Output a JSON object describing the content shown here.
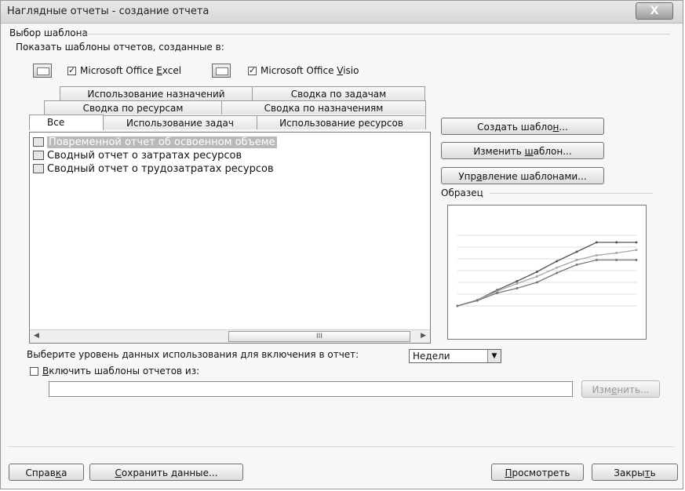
{
  "window": {
    "title": "Наглядные отчеты - создание отчета",
    "close_label": "X"
  },
  "templates_group": {
    "label": "Выбор шаблона",
    "show_label": "Показать шаблоны отчетов, созданные в:",
    "excel_label": "Microsoft Office Excel",
    "excel_checked": true,
    "visio_label": "Microsoft Office Visio",
    "visio_checked": true
  },
  "tabs": {
    "row1": [
      "Использование назначений",
      "Сводка по задачам"
    ],
    "row2": [
      "Сводка по ресурсам",
      "Сводка по назначениям"
    ],
    "row3": [
      "Все",
      "Использование задач",
      "Использование ресурсов"
    ],
    "active": "Все"
  },
  "reports": [
    {
      "label": "Повременной отчет об освоенном объеме",
      "selected": true
    },
    {
      "label": "Сводный отчет о затратах ресурсов",
      "selected": false
    },
    {
      "label": "Сводный отчет о трудозатратах ресурсов",
      "selected": false
    }
  ],
  "scrollbar": {
    "thumb_label": "III"
  },
  "buttons": {
    "create_template": "Создать шаблон...",
    "edit_template": "Изменить шаблон...",
    "manage_templates": "Управление шаблонами...",
    "change": "Изменить...",
    "help": "Справка",
    "save_data": "Сохранить данные...",
    "view": "Просмотреть",
    "close": "Закрыть"
  },
  "sample": {
    "label": "Образец"
  },
  "usage_level": {
    "label": "Выберите уровень данных использования для включения в отчет:",
    "value": "Недели"
  },
  "include_templates": {
    "label": "Включить шаблоны отчетов из:",
    "checked": false,
    "path": ""
  },
  "chart_data": {
    "type": "line",
    "x": [
      1,
      2,
      3,
      4,
      5,
      6,
      7,
      8,
      9,
      10
    ],
    "series": [
      {
        "values": [
          0,
          1.0,
          2.7,
          4.2,
          5.8,
          7.6,
          9.2,
          10.8,
          10.8,
          10.8
        ]
      },
      {
        "values": [
          0,
          1.0,
          2.5,
          3.8,
          5.0,
          6.5,
          7.8,
          8.6,
          9.0,
          9.5
        ]
      },
      {
        "values": [
          0,
          0.9,
          2.2,
          3.0,
          4.0,
          5.6,
          7.0,
          7.8,
          7.8,
          7.8
        ]
      }
    ],
    "ylim": [
      0,
      12
    ],
    "grid": true,
    "colors": [
      "#555555",
      "#a7a7a7",
      "#777777"
    ]
  }
}
